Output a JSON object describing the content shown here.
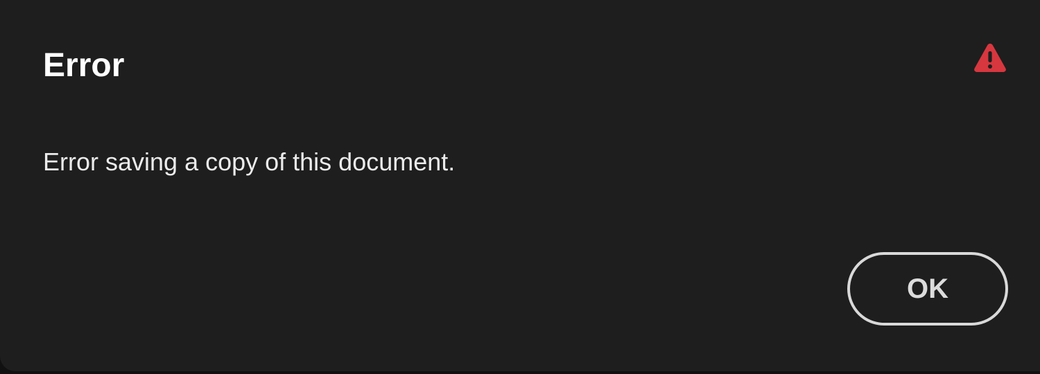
{
  "dialog": {
    "title": "Error",
    "message": "Error saving a copy of this document.",
    "icon": "alert-triangle-icon",
    "ok_label": "OK"
  },
  "colors": {
    "background": "#1e1e1e",
    "title_text": "#ffffff",
    "body_text": "#ebebeb",
    "alert_icon": "#d7373f",
    "button_border": "#d9d9d9"
  }
}
